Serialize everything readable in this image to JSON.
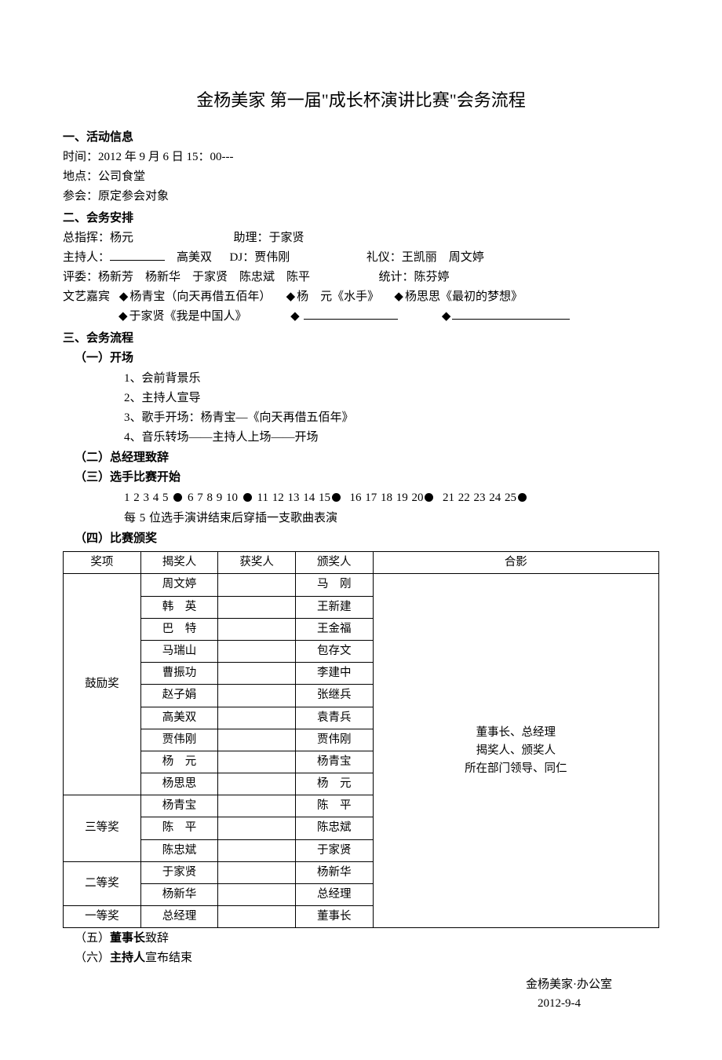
{
  "title": "金杨美家 第一届\"成长杯演讲比赛\"会务流程",
  "sec1": {
    "head": "一、活动信息",
    "time_label": "时间：",
    "time_value": "2012 年 9 月 6 日 15：00---",
    "place_label": "地点：",
    "place_value": "公司食堂",
    "att_label": "参会：",
    "att_value": "原定参会对象"
  },
  "sec2": {
    "head": "二、会务安排",
    "cmd_label": "总指挥：",
    "cmd_value": "杨元",
    "assist_label": "助理：",
    "assist_value": "于家贤",
    "host_label": "主持人：",
    "host2": "高美双",
    "dj_label": "DJ：",
    "dj_value": "贾伟刚",
    "etq_label": "礼仪：",
    "etq_value": "王凯丽　周文婷",
    "judge_label": "评委：",
    "judge_value": "杨新芳　杨新华　于家贤　陈忠斌　陈平",
    "stat_label": "统计：",
    "stat_value": "陈芬婷",
    "guest_label": "文艺嘉宾",
    "g1": "杨青宝（向天再借五佰年）",
    "g2a": "杨　元",
    "g2b": "《水手》",
    "g3a": "杨思思",
    "g3b": "《最初的梦想》",
    "g4": "于家贤《我是中国人》"
  },
  "sec3": {
    "head": "三、会务流程",
    "p1_head": "（一）开场",
    "p1_items": [
      "1、会前背景乐",
      "2、主持人宣导",
      "3、歌手开场：杨青宝—《向天再借五佰年》",
      "4、音乐转场——主持人上场——开场"
    ],
    "p2_head": "（二）总经理致辞",
    "p3_head": "（三）选手比赛开始",
    "p3_seq_a": "1 2 3 4 5",
    "p3_seq_b": "6 7 8 9 10",
    "p3_seq_c": "11 12 13 14 15",
    "p3_seq_d": "16 17 18 19 20",
    "p3_seq_e": "21 22 23 24 25",
    "p3_note": "每 5 位选手演讲结束后穿插一支歌曲表演",
    "p4_head": "（四）比赛颁奖",
    "p5_head": "（五）董事长致辞",
    "p5_head_b": "董事长",
    "p5_head_c": "致辞",
    "p6_head_b": "主持人",
    "p6_head_c": "宣布结束",
    "p6_prefix": "（六）"
  },
  "table": {
    "h1": "奖项",
    "h2": "揭奖人",
    "h3": "获奖人",
    "h4": "颁奖人",
    "h5": "合影",
    "cat_encourage": "鼓励奖",
    "cat_third": "三等奖",
    "cat_second": "二等奖",
    "cat_first": "一等奖",
    "rows": [
      {
        "a": "周文婷",
        "b": "马　刚"
      },
      {
        "a": "韩　英",
        "b": "王新建"
      },
      {
        "a": "巴　特",
        "b": "王金福"
      },
      {
        "a": "马瑞山",
        "b": "包存文"
      },
      {
        "a": "曹振功",
        "b": "李建中"
      },
      {
        "a": "赵子娟",
        "b": "张继兵"
      },
      {
        "a": "高美双",
        "b": "袁青兵"
      },
      {
        "a": "贾伟刚",
        "b": "贾伟刚"
      },
      {
        "a": "杨　元",
        "b": "杨青宝"
      },
      {
        "a": "杨思思",
        "b": "杨　元"
      },
      {
        "a": "杨青宝",
        "b": "陈　平"
      },
      {
        "a": "陈　平",
        "b": "陈忠斌"
      },
      {
        "a": "陈忠斌",
        "b": "于家贤"
      },
      {
        "a": "于家贤",
        "b": "杨新华"
      },
      {
        "a": "杨新华",
        "b": "总经理"
      },
      {
        "a": "总经理",
        "b": "董事长"
      }
    ],
    "photo1": "董事长、总经理",
    "photo2": "揭奖人、颁奖人",
    "photo3": "所在部门领导、同仁"
  },
  "footer": {
    "org": "金杨美家·办公室",
    "date": "2012-9-4"
  }
}
